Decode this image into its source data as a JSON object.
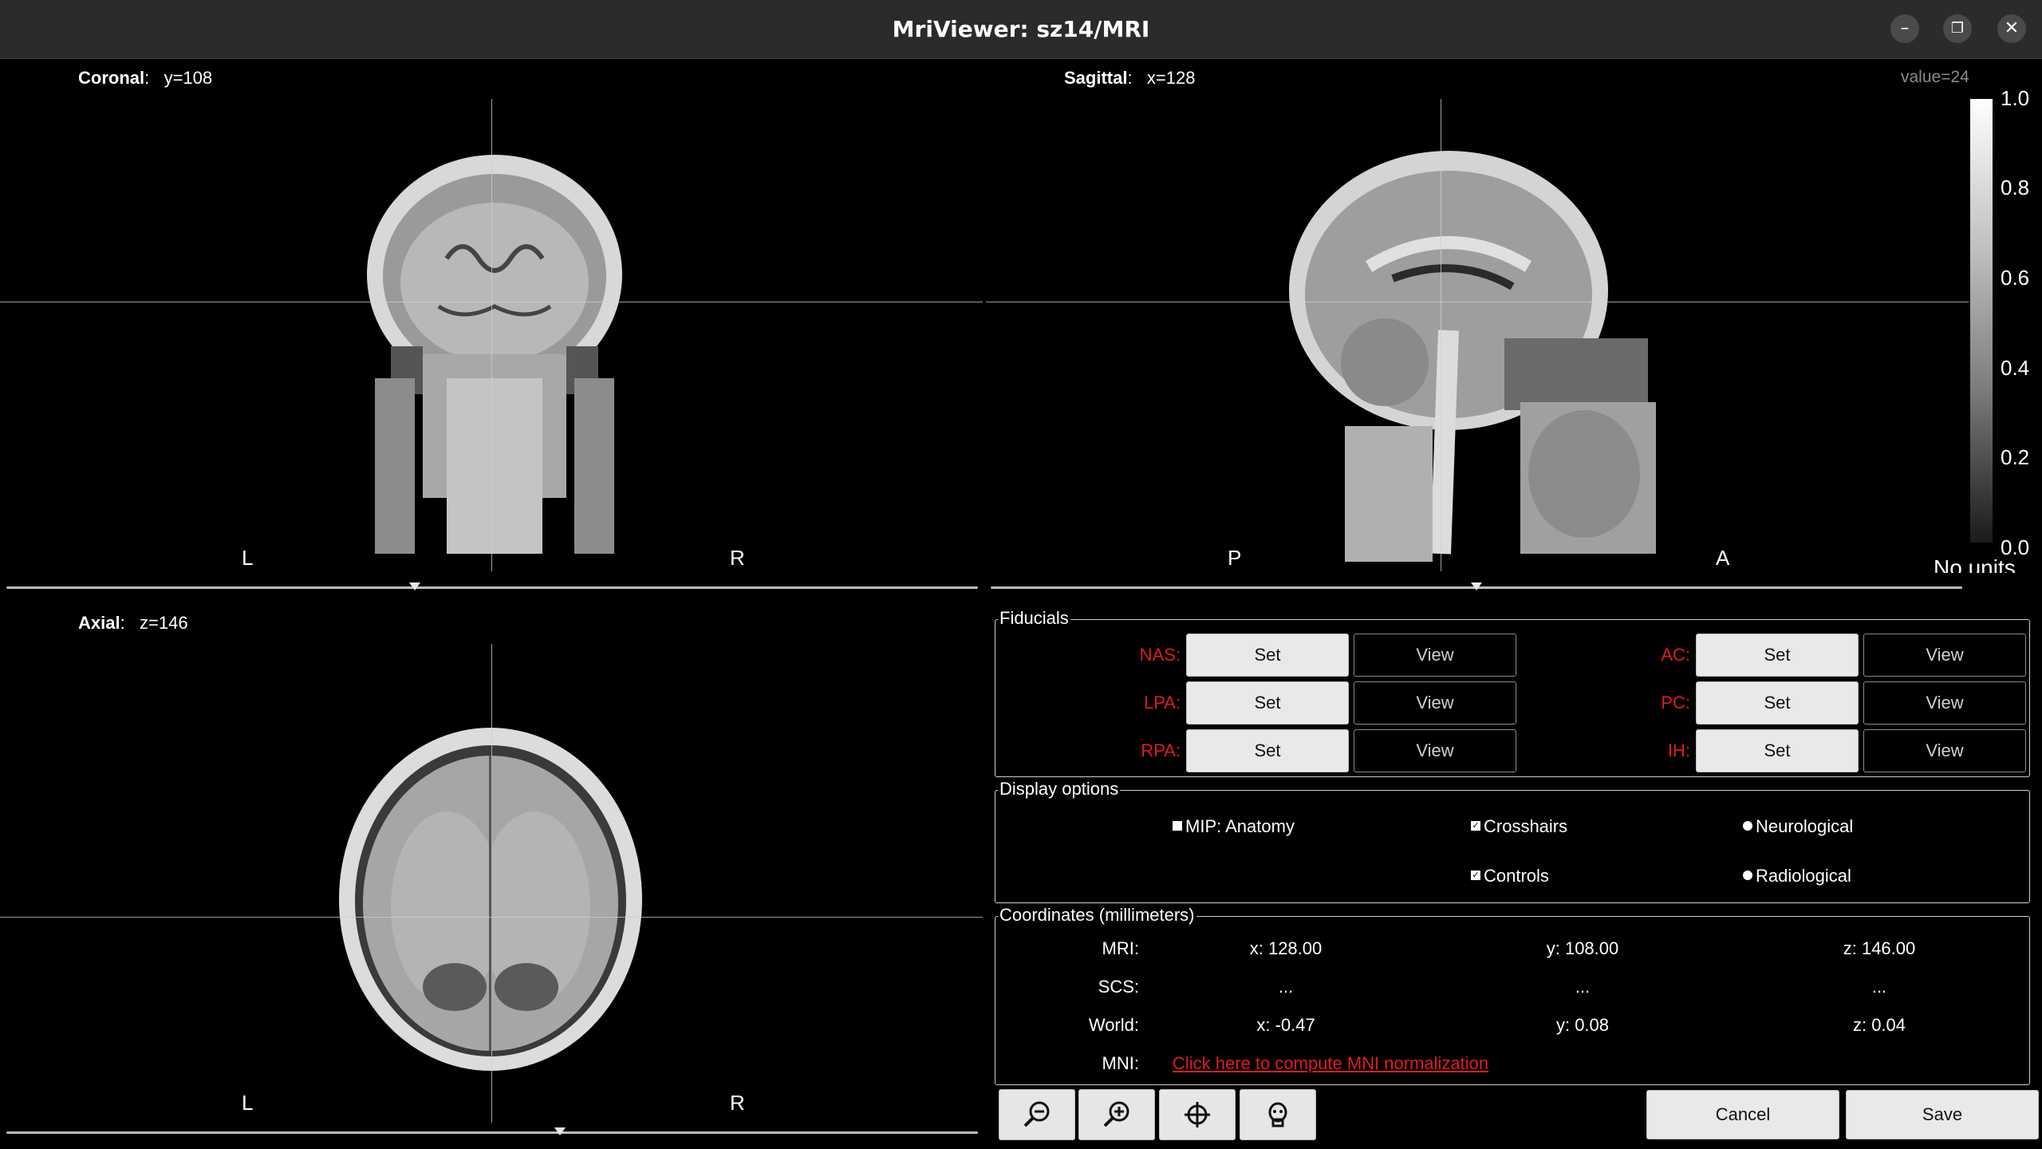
{
  "window": {
    "title": "MriViewer: sz14/MRI",
    "minimize_glyph": "–",
    "maximize_glyph": "❐",
    "close_glyph": "✕"
  },
  "views": {
    "coronal": {
      "name": "Coronal",
      "coord": "y=108",
      "left": "L",
      "right": "R",
      "slice_position": 0.42
    },
    "sagittal": {
      "name": "Sagittal",
      "coord": "x=128",
      "left": "P",
      "right": "A",
      "slice_position": 0.5
    },
    "axial": {
      "name": "Axial",
      "coord": "z=146",
      "left": "L",
      "right": "R",
      "slice_position": 0.57
    }
  },
  "colorbar": {
    "value_label": "value=24",
    "ticks": [
      "1.0",
      "0.8",
      "0.6",
      "0.4",
      "0.2",
      "0.0"
    ],
    "units": "No units"
  },
  "fiducials": {
    "title": "Fiducials",
    "set_label": "Set",
    "view_label": "View",
    "left": [
      "NAS:",
      "LPA:",
      "RPA:"
    ],
    "right": [
      "AC:",
      "PC:",
      "IH:"
    ]
  },
  "display_options": {
    "title": "Display options",
    "mip": "MIP: Anatomy",
    "crosshairs": "Crosshairs",
    "controls": "Controls",
    "neurological": "Neurological",
    "radiological": "Radiological"
  },
  "coordinates": {
    "title": "Coordinates (millimeters)",
    "rows": [
      {
        "label": "MRI:",
        "x": "x: 128.00",
        "y": "y: 108.00",
        "z": "z: 146.00"
      },
      {
        "label": "SCS:",
        "x": "...",
        "y": "...",
        "z": "..."
      },
      {
        "label": "World:",
        "x": "x: -0.47",
        "y": "y: 0.08",
        "z": "z: 0.04"
      }
    ],
    "mni_label": "MNI:",
    "mni_link": "Click here to compute MNI normalization"
  },
  "toolbar": {
    "zoom_out_icon": "zoom-out-icon",
    "zoom_in_icon": "zoom-in-icon",
    "crosshair_icon": "crosshair-icon",
    "head_icon": "head-icon",
    "cancel_label": "Cancel",
    "save_label": "Save"
  }
}
